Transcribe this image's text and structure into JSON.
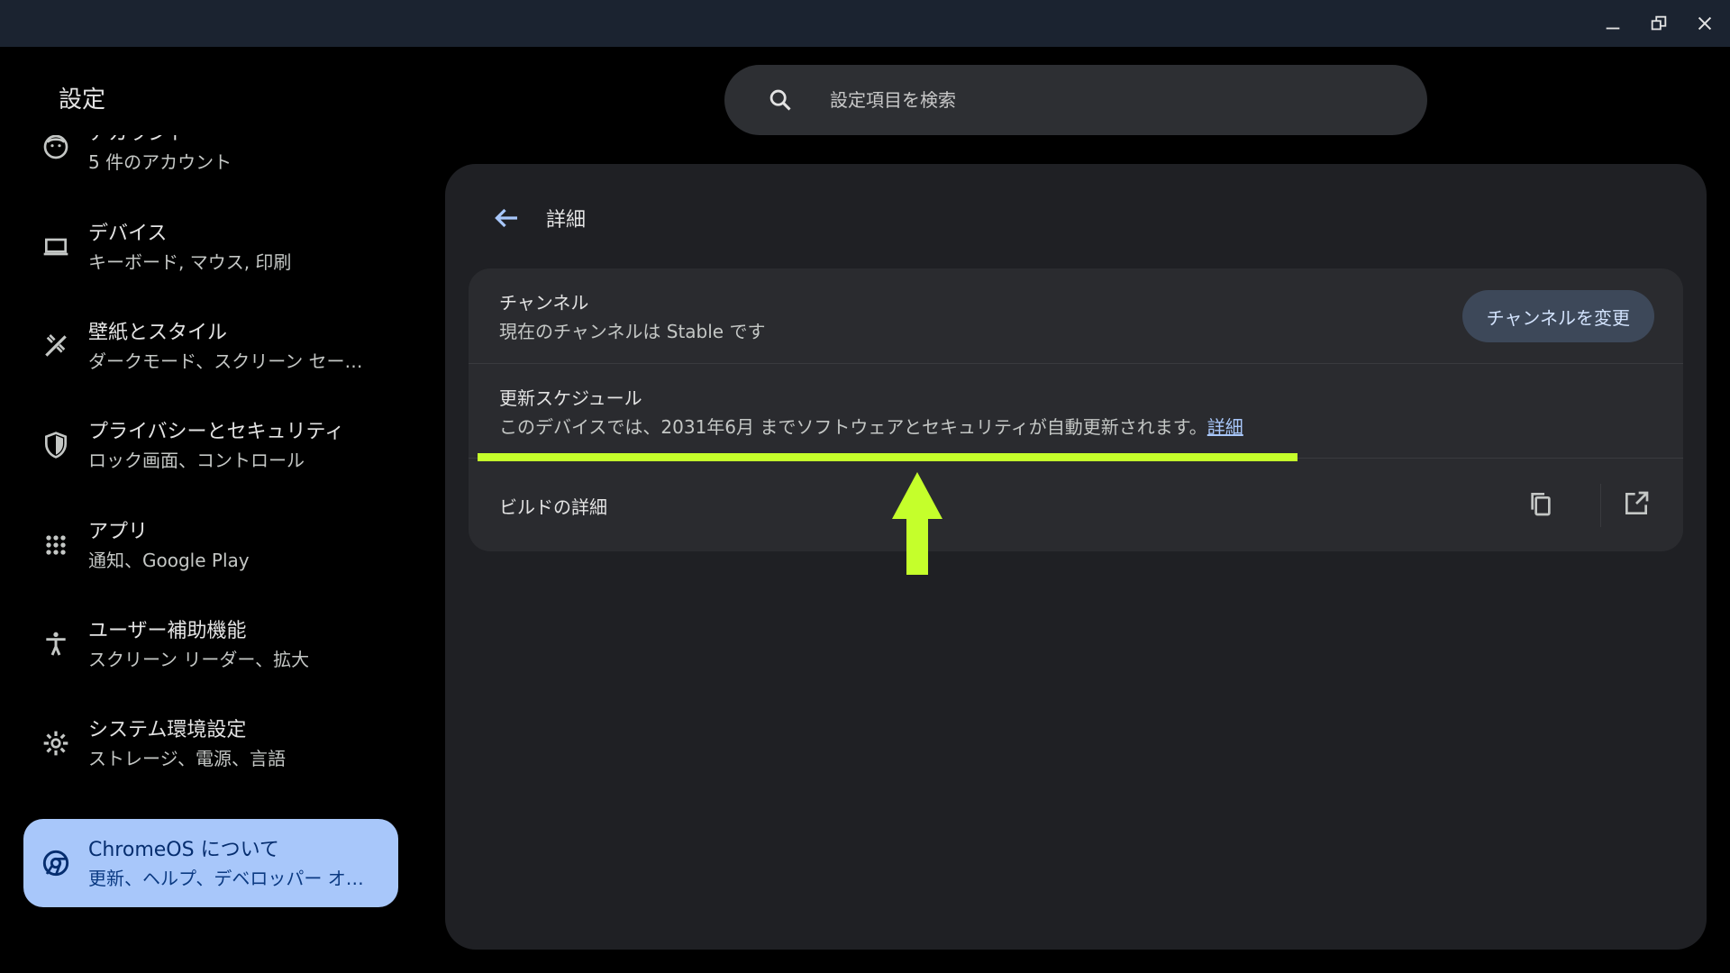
{
  "window": {
    "minimize_icon": "minimize-icon",
    "restore_icon": "restore-icon",
    "close_icon": "close-icon"
  },
  "app_title": "設定",
  "search": {
    "placeholder": "設定項目を検索",
    "icon": "search-icon"
  },
  "sidebar": {
    "items": [
      {
        "title": "アカウント",
        "subtitle": "5 件のアカウント",
        "icon": "account-icon"
      },
      {
        "title": "デバイス",
        "subtitle": "キーボード, マウス, 印刷",
        "icon": "laptop-icon"
      },
      {
        "title": "壁紙とスタイル",
        "subtitle": "ダークモード、スクリーン セー…",
        "icon": "palette-icon"
      },
      {
        "title": "プライバシーとセキュリティ",
        "subtitle": "ロック画面、コントロール",
        "icon": "shield-icon"
      },
      {
        "title": "アプリ",
        "subtitle": "通知、Google Play",
        "icon": "apps-grid-icon"
      },
      {
        "title": "ユーザー補助機能",
        "subtitle": "スクリーン リーダー、拡大",
        "icon": "accessibility-icon"
      },
      {
        "title": "システム環境設定",
        "subtitle": "ストレージ、電源、言語",
        "icon": "gear-icon"
      },
      {
        "title": "ChromeOS について",
        "subtitle": "更新、ヘルプ、デベロッパー オ…",
        "icon": "chrome-icon",
        "active": true
      }
    ]
  },
  "main": {
    "page_title": "詳細",
    "back_icon": "back-arrow-icon",
    "channel": {
      "title": "チャンネル",
      "subtitle": "現在のチャンネルは Stable です",
      "button_label": "チャンネルを変更"
    },
    "update_schedule": {
      "title": "更新スケジュール",
      "subtitle": "このデバイスでは、2031年6月 までソフトウェアとセキュリティが自動更新されます。",
      "link": "詳細"
    },
    "build_details": {
      "title": "ビルドの詳細",
      "copy_icon": "copy-icon",
      "open_icon": "open-external-icon"
    }
  },
  "colors": {
    "highlight": "#c5ff2b",
    "active_nav": "#a8c7fa",
    "panel": "#1f2024",
    "card": "#2a2b2f"
  }
}
